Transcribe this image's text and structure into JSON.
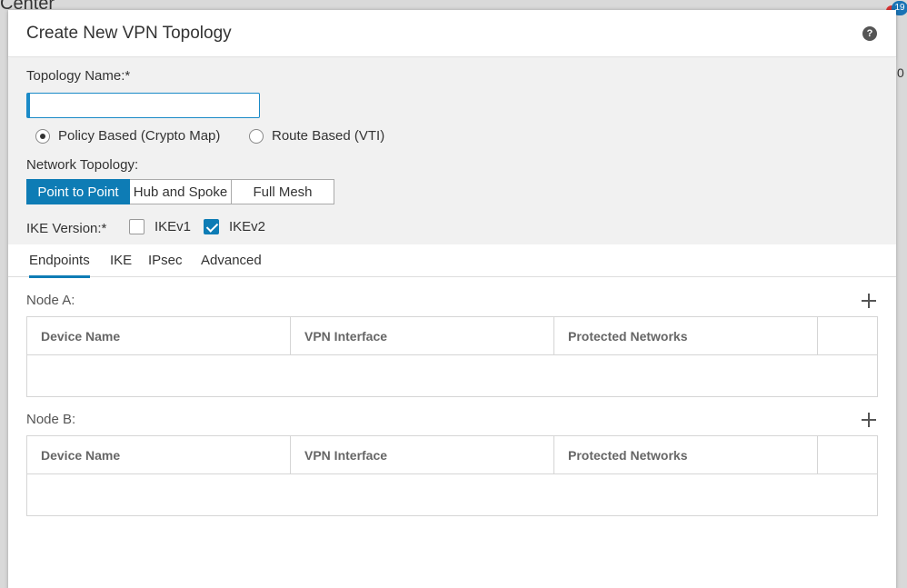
{
  "background": {
    "title_fragment": "Center",
    "edge_text": "0",
    "badge_count": "19"
  },
  "modal": {
    "title": "Create New VPN Topology",
    "help_icon": "?"
  },
  "topology_name": {
    "label": "Topology Name:*",
    "value": "",
    "placeholder": ""
  },
  "policy_type": {
    "options": [
      {
        "label": "Policy Based (Crypto Map)",
        "selected": true
      },
      {
        "label": "Route Based (VTI)",
        "selected": false
      }
    ]
  },
  "network_topology": {
    "label": "Network Topology:",
    "options": [
      {
        "label": "Point to Point",
        "active": true
      },
      {
        "label": "Hub and Spoke",
        "active": false
      },
      {
        "label": "Full Mesh",
        "active": false
      }
    ]
  },
  "ike_version": {
    "label": "IKE Version:*",
    "options": [
      {
        "label": "IKEv1",
        "checked": false
      },
      {
        "label": "IKEv2",
        "checked": true
      }
    ]
  },
  "tabs": [
    {
      "label": "Endpoints",
      "active": true
    },
    {
      "label": "IKE",
      "active": false
    },
    {
      "label": "IPsec",
      "active": false
    },
    {
      "label": "Advanced",
      "active": false
    }
  ],
  "node_a": {
    "label": "Node A:",
    "columns": [
      "Device Name",
      "VPN Interface",
      "Protected Networks",
      ""
    ]
  },
  "node_b": {
    "label": "Node B:",
    "columns": [
      "Device Name",
      "VPN Interface",
      "Protected Networks",
      ""
    ]
  },
  "colors": {
    "accent": "#0e7cb5",
    "config_bg": "#f1f1f1"
  }
}
